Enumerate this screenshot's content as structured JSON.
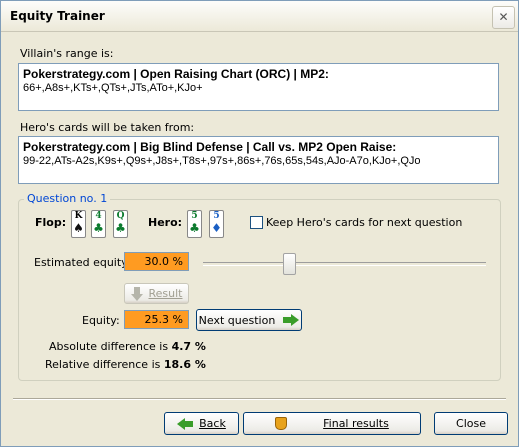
{
  "window": {
    "title": "Equity Trainer",
    "close_glyph": "✕"
  },
  "villain": {
    "label": "Villain's range is:",
    "heading": "Pokerstrategy.com | Open Raising Chart (ORC) | MP2:",
    "range": "66+,A8s+,KTs+,QTs+,JTs,ATo+,KJo+"
  },
  "hero_source": {
    "label": "Hero's cards will be taken from:",
    "heading": "Pokerstrategy.com | Big Blind Defense | Call vs. MP2 Open Raise:",
    "range": "99-22,ATs-A2s,K9s+,Q9s+,J8s+,T8s+,97s+,86s+,76s,65s,54s,AJo-A7o,KJo+,QJo"
  },
  "question": {
    "legend": "Question no. 1",
    "flop_label": "Flop:",
    "hero_label": "Hero:",
    "flop_cards": [
      {
        "rank": "K",
        "suit": "♠",
        "color": "#111111"
      },
      {
        "rank": "4",
        "suit": "♣",
        "color": "#0b7a2d"
      },
      {
        "rank": "Q",
        "suit": "♣",
        "color": "#0b7a2d"
      }
    ],
    "hero_cards": [
      {
        "rank": "5",
        "suit": "♣",
        "color": "#0b7a2d"
      },
      {
        "rank": "5",
        "suit": "♦",
        "color": "#1a5fc4"
      }
    ],
    "keep_label": "Keep Hero's cards for next question",
    "keep_checked": false,
    "estimated_label": "Estimated equity:",
    "estimated_value": "30.0 %",
    "slider_value_percent": 30,
    "result_button": "Result",
    "equity_label": "Equity:",
    "equity_value": "25.3 %",
    "next_button": "Next question",
    "abs_prefix": "Absolute difference is ",
    "abs_value": "4.7 %",
    "rel_prefix": "Relative difference is ",
    "rel_value": "18.6 %"
  },
  "footer": {
    "back": "Back",
    "final": "Final results",
    "close": "Close"
  },
  "colors": {
    "accent_orange": "#ff9b21",
    "legend_blue": "#0046d5",
    "arrow_green": "#3a9d2a"
  }
}
